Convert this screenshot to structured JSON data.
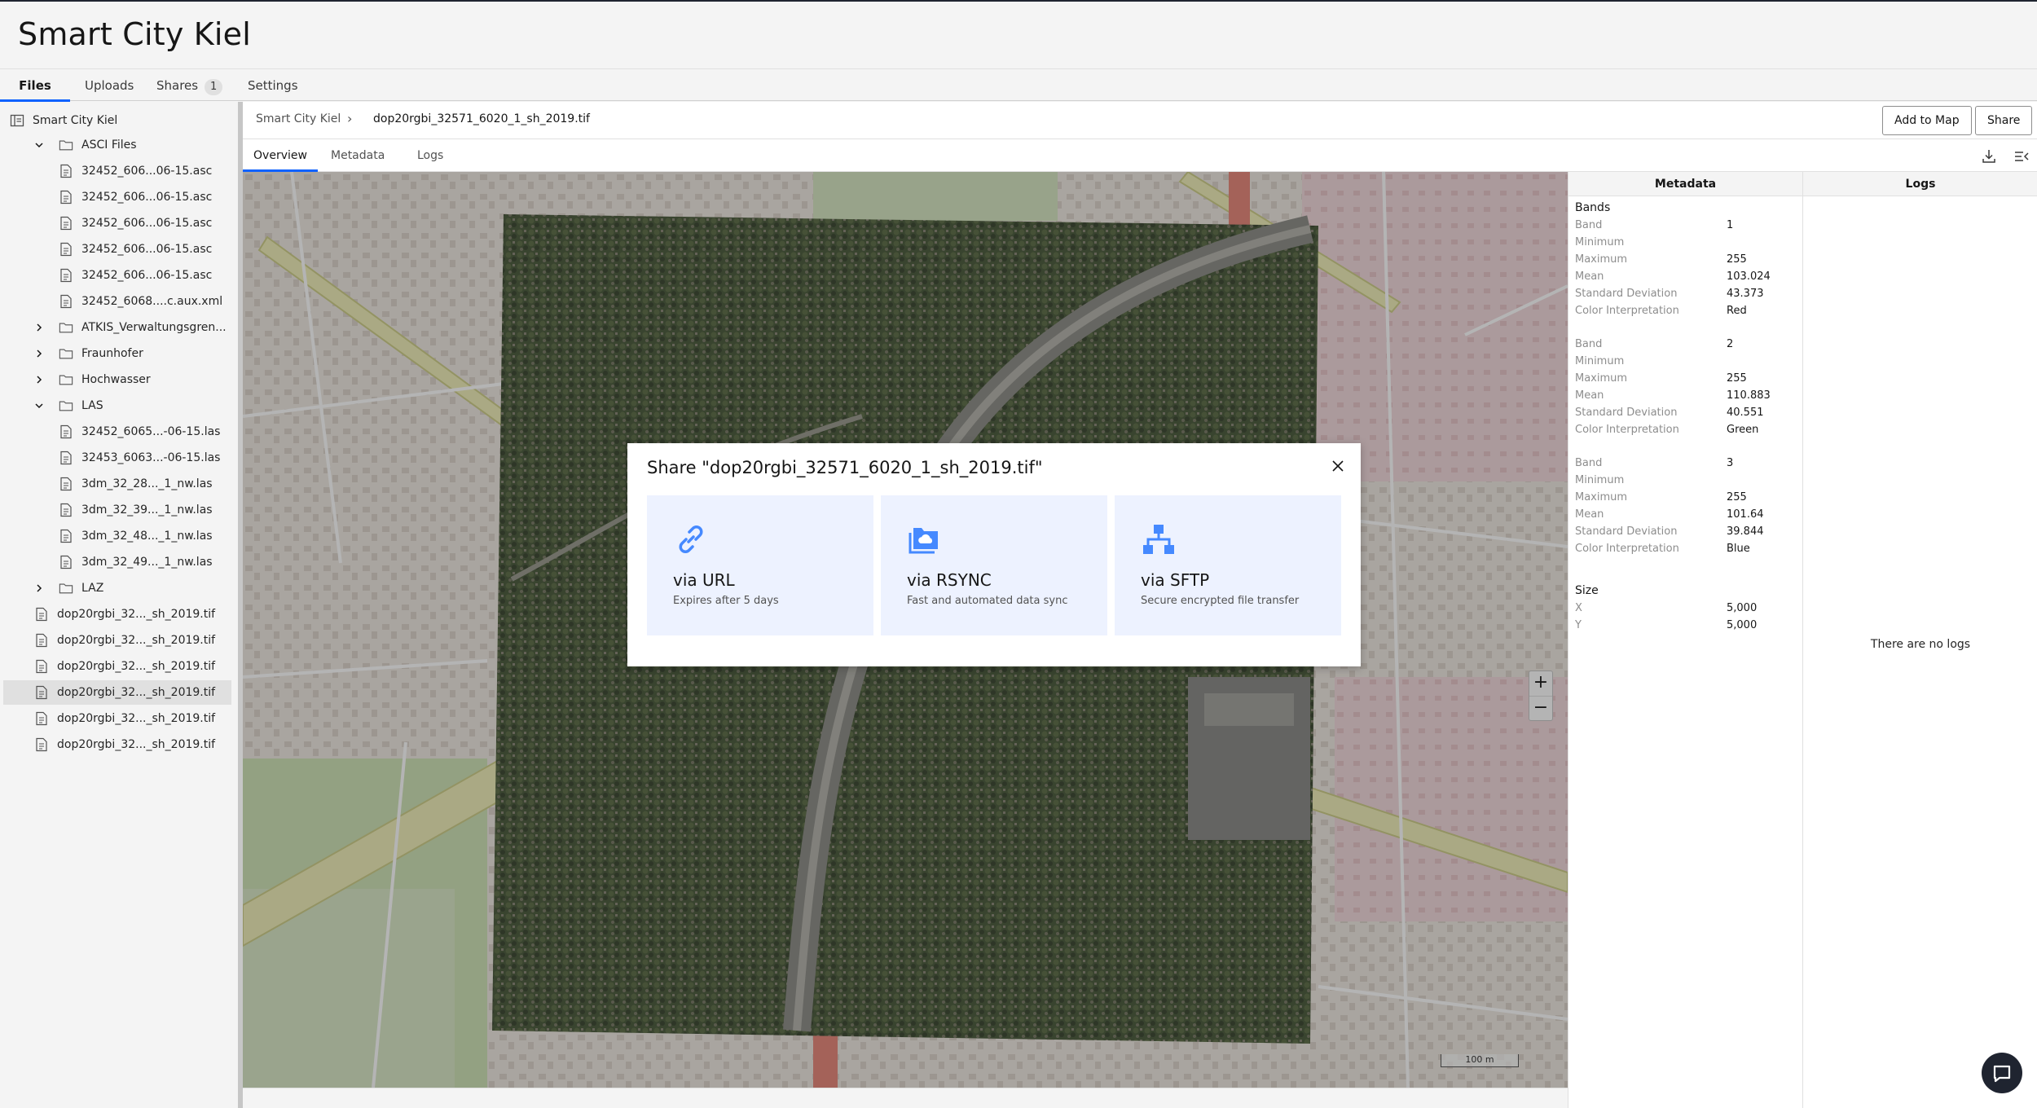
{
  "app": {
    "title": "Smart City Kiel"
  },
  "tabs": [
    {
      "label": "Files"
    },
    {
      "label": "Uploads"
    },
    {
      "label": "Shares",
      "badge": "1"
    },
    {
      "label": "Settings"
    }
  ],
  "sidebar": {
    "root": "Smart City Kiel",
    "items": [
      {
        "label": "ASCI Files"
      },
      {
        "label": "32452_606...06-15.asc"
      },
      {
        "label": "32452_606...06-15.asc"
      },
      {
        "label": "32452_606...06-15.asc"
      },
      {
        "label": "32452_606...06-15.asc"
      },
      {
        "label": "32452_606...06-15.asc"
      },
      {
        "label": "32452_6068....c.aux.xml"
      },
      {
        "label": "ATKIS_Verwaltungsgren..."
      },
      {
        "label": "Fraunhofer"
      },
      {
        "label": "Hochwasser"
      },
      {
        "label": "LAS"
      },
      {
        "label": "32452_6065...-06-15.las"
      },
      {
        "label": "32453_6063...-06-15.las"
      },
      {
        "label": "3dm_32_28..._1_nw.las"
      },
      {
        "label": "3dm_32_39..._1_nw.las"
      },
      {
        "label": "3dm_32_48..._1_nw.las"
      },
      {
        "label": "3dm_32_49..._1_nw.las"
      },
      {
        "label": "LAZ"
      },
      {
        "label": "dop20rgbi_32..._sh_2019.tif"
      },
      {
        "label": "dop20rgbi_32..._sh_2019.tif"
      },
      {
        "label": "dop20rgbi_32..._sh_2019.tif"
      },
      {
        "label": "dop20rgbi_32..._sh_2019.tif"
      },
      {
        "label": "dop20rgbi_32..._sh_2019.tif"
      },
      {
        "label": "dop20rgbi_32..._sh_2019.tif"
      }
    ]
  },
  "breadcrumb": {
    "root": "Smart City Kiel",
    "current": "dop20rgbi_32571_6020_1_sh_2019.tif"
  },
  "actions": {
    "add_to_map": "Add to Map",
    "share": "Share"
  },
  "subtabs": [
    "Overview",
    "Metadata",
    "Logs"
  ],
  "metadata": {
    "heading": "Metadata",
    "bands_label": "Bands",
    "keys": {
      "band": "Band",
      "minimum": "Minimum",
      "maximum": "Maximum",
      "mean": "Mean",
      "std": "Standard Deviation",
      "color": "Color Interpretation"
    },
    "bands": [
      {
        "band": "1",
        "minimum": "",
        "maximum": "255",
        "mean": "103.024",
        "std": "43.373",
        "color": "Red"
      },
      {
        "band": "2",
        "minimum": "",
        "maximum": "255",
        "mean": "110.883",
        "std": "40.551",
        "color": "Green"
      },
      {
        "band": "3",
        "minimum": "",
        "maximum": "255",
        "mean": "101.64",
        "std": "39.844",
        "color": "Blue"
      }
    ],
    "size_label": "Size",
    "size": {
      "x_label": "X",
      "x": "5,000",
      "y_label": "Y",
      "y": "5,000"
    }
  },
  "logs": {
    "heading": "Logs",
    "empty": "There are no logs"
  },
  "map": {
    "scale": "100 m"
  },
  "modal": {
    "title": "Share \"dop20rgbi_32571_6020_1_sh_2019.tif\"",
    "options": [
      {
        "title": "via URL",
        "desc": "Expires after 5 days",
        "icon": "link-icon"
      },
      {
        "title": "via RSYNC",
        "desc": "Fast and automated data sync",
        "icon": "cloud-folder-icon"
      },
      {
        "title": "via SFTP",
        "desc": "Secure encrypted file transfer",
        "icon": "network-tree-icon"
      }
    ]
  },
  "colors": {
    "accent": "#0f62fe",
    "option_bg": "#edf2ff",
    "icon_blue": "#4589ff"
  }
}
